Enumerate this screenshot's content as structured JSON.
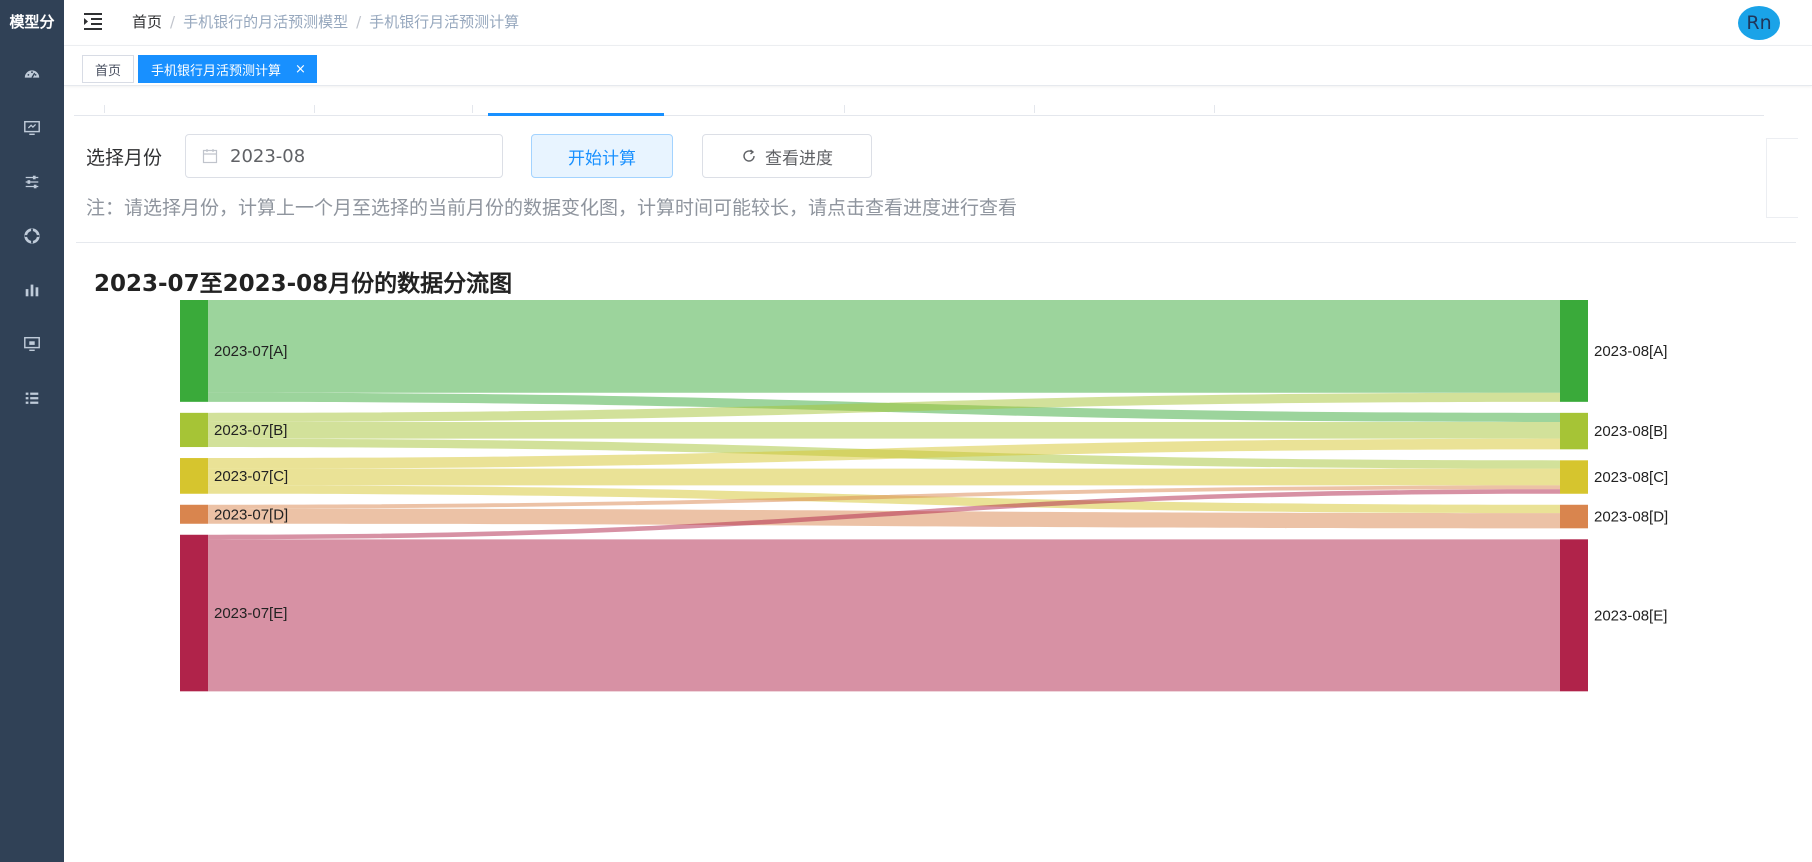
{
  "app": {
    "logo": "模型分"
  },
  "sidebar": {
    "icons": [
      "dashboard-icon",
      "monitor-icon",
      "sliders-icon",
      "lifebuoy-icon",
      "bar-chart-icon",
      "screen-icon",
      "list-icon"
    ]
  },
  "header": {
    "breadcrumb": [
      "首页",
      "手机银行的月活预测模型",
      "手机银行月活预测计算"
    ],
    "avatar_text": "Rn"
  },
  "tags": {
    "home": "首页",
    "active": "手机银行月活预测计算",
    "close": "×"
  },
  "form": {
    "label": "选择月份",
    "month_value": "2023-08",
    "start_button": "开始计算",
    "progress_button": "查看进度",
    "note": "注：请选择月份，计算上一个月至选择的当前月份的数据变化图，计算时间可能较长，请点击查看进度进行查看"
  },
  "chart_data": {
    "type": "sankey",
    "title": "2023-07至2023-08月份的数据分流图",
    "left_nodes": [
      "2023-07[A]",
      "2023-07[B]",
      "2023-07[C]",
      "2023-07[D]",
      "2023-07[E]"
    ],
    "right_nodes": [
      "2023-08[A]",
      "2023-08[B]",
      "2023-08[C]",
      "2023-08[D]",
      "2023-08[E]"
    ],
    "colors": [
      "#3aaa3a",
      "#a6c436",
      "#d6c52e",
      "#d9854e",
      "#b0234a"
    ],
    "links": [
      {
        "source": 0,
        "target": 0,
        "value": 122
      },
      {
        "source": 0,
        "target": 1,
        "value": 12
      },
      {
        "source": 1,
        "target": 0,
        "value": 12
      },
      {
        "source": 1,
        "target": 1,
        "value": 22
      },
      {
        "source": 1,
        "target": 2,
        "value": 11
      },
      {
        "source": 2,
        "target": 1,
        "value": 14
      },
      {
        "source": 2,
        "target": 2,
        "value": 22
      },
      {
        "source": 2,
        "target": 3,
        "value": 11
      },
      {
        "source": 3,
        "target": 2,
        "value": 5
      },
      {
        "source": 3,
        "target": 3,
        "value": 20
      },
      {
        "source": 4,
        "target": 2,
        "value": 6
      },
      {
        "source": 4,
        "target": 4,
        "value": 200
      }
    ]
  }
}
